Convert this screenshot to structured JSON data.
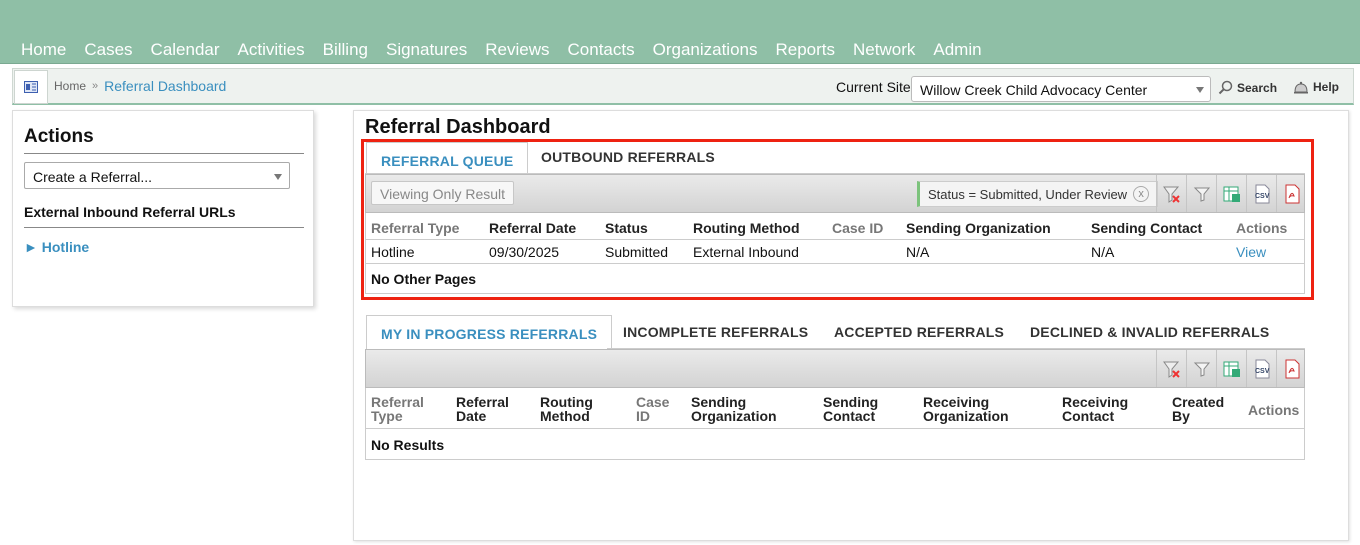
{
  "nav": {
    "items": [
      "Home",
      "Cases",
      "Calendar",
      "Activities",
      "Billing",
      "Signatures",
      "Reviews",
      "Contacts",
      "Organizations",
      "Reports",
      "Network",
      "Admin"
    ]
  },
  "breadcrumb": {
    "home": "Home",
    "separator": "»",
    "current": "Referral Dashboard"
  },
  "header": {
    "site_label": "Current Site",
    "site_value": "Willow Creek Child Advocacy Center",
    "search_label": "Search",
    "help_label": "Help"
  },
  "actions": {
    "title": "Actions",
    "select_value": "Create a Referral...",
    "subtitle": "External Inbound Referral URLs",
    "link_label": "Hotline",
    "link_arrow": "►"
  },
  "page": {
    "title": "Referral Dashboard"
  },
  "queue": {
    "tabs": [
      "REFERRAL QUEUE",
      "OUTBOUND REFERRALS"
    ],
    "viewing_button": "Viewing Only Result",
    "filter_chip": "Status = Submitted, Under Review",
    "filter_remove": "x",
    "columns": [
      "Referral Type",
      "Referral Date",
      "Status",
      "Routing Method",
      "Case ID",
      "Sending Organization",
      "Sending Contact",
      "Actions"
    ],
    "rows": [
      [
        "Hotline",
        "09/30/2025",
        "Submitted",
        "External Inbound",
        "",
        "N/A",
        "N/A",
        "View"
      ]
    ],
    "footer": "No Other Pages"
  },
  "progress": {
    "tabs": [
      "MY IN PROGRESS REFERRALS",
      "INCOMPLETE REFERRALS",
      "ACCEPTED REFERRALS",
      "DECLINED & INVALID REFERRALS"
    ],
    "columns": [
      [
        "Referral",
        "Type"
      ],
      [
        "Referral",
        "Date"
      ],
      [
        "Routing",
        "Method"
      ],
      [
        "Case",
        "ID"
      ],
      [
        "Sending",
        "Organization"
      ],
      [
        "Sending",
        "Contact"
      ],
      [
        "Receiving",
        "Organization"
      ],
      [
        "Receiving",
        "Contact"
      ],
      [
        "Created",
        "By"
      ],
      [
        "Actions",
        ""
      ]
    ],
    "empty": "No Results"
  },
  "toolbar_icons": {
    "clear_filter": "clear-filter-icon",
    "filter": "filter-icon",
    "excel": "excel-export-icon",
    "csv_label": "CSV",
    "pdf": "pdf-export-icon"
  }
}
